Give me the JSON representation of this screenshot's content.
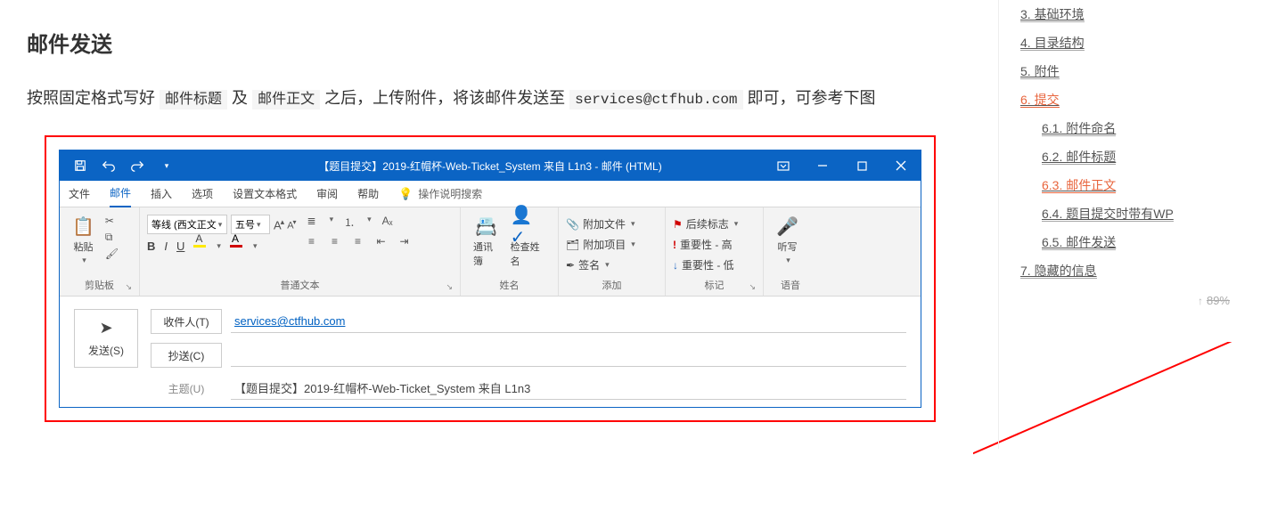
{
  "heading": "邮件发送",
  "paragraph": {
    "p1": "按照固定格式写好 ",
    "code1": "邮件标题",
    "p2": " 及 ",
    "code2": "邮件正文",
    "p3": " 之后，上传附件，将该邮件发送至 ",
    "email": "services@ctfhub.com",
    "p4": " 即可，可参考下图"
  },
  "outlook": {
    "title": "【题目提交】2019-红帽杯-Web-Ticket_System 来自 L1n3  -  邮件 (HTML)",
    "tabs": {
      "file": "文件",
      "mail": "邮件",
      "insert": "插入",
      "options": "选项",
      "format": "设置文本格式",
      "review": "审阅",
      "help": "帮助",
      "tell": "操作说明搜索"
    },
    "groups": {
      "clipboard": "剪贴板",
      "paste": "粘贴",
      "font": "普通文本",
      "font_name": "等线 (西文正文",
      "font_size": "五号",
      "names": "姓名",
      "addressbook": "通讯簿",
      "checknames": "检查姓名",
      "add": "添加",
      "attach_file": "附加文件",
      "attach_item": "附加项目",
      "signature": "签名",
      "mark": "标记",
      "followup": "后续标志",
      "hi": "重要性 - 高",
      "lo": "重要性 - 低",
      "voice": "语音",
      "dictate": "听写"
    },
    "fields": {
      "send": "发送(S)",
      "to_label": "收件人(T)",
      "to_value": "services@ctfhub.com",
      "cc_label": "抄送(C)",
      "subj_label": "主题(U)",
      "subj_value": "【题目提交】2019-红帽杯-Web-Ticket_System 来自 L1n3"
    }
  },
  "toc": [
    {
      "label": "3. 基础环境",
      "sub": false,
      "active": false,
      "u": true
    },
    {
      "label": "4. 目录结构",
      "sub": false,
      "active": false,
      "u": true
    },
    {
      "label": "5. 附件",
      "sub": false,
      "active": false,
      "u": true
    },
    {
      "label": "6. 提交",
      "sub": false,
      "active": true,
      "u": true
    },
    {
      "label": "6.1. 附件命名",
      "sub": true,
      "active": false,
      "u": true
    },
    {
      "label": "6.2. 邮件标题",
      "sub": true,
      "active": false,
      "u": true
    },
    {
      "label": "6.3. 邮件正文",
      "sub": true,
      "active": true,
      "u": true
    },
    {
      "label": "6.4. 题目提交时带有WP",
      "sub": true,
      "active": false,
      "u": true
    },
    {
      "label": "6.5. 邮件发送",
      "sub": true,
      "active": false,
      "u": true
    },
    {
      "label": "7. 隐藏的信息",
      "sub": false,
      "active": false,
      "u": true
    }
  ],
  "progress": "89%"
}
